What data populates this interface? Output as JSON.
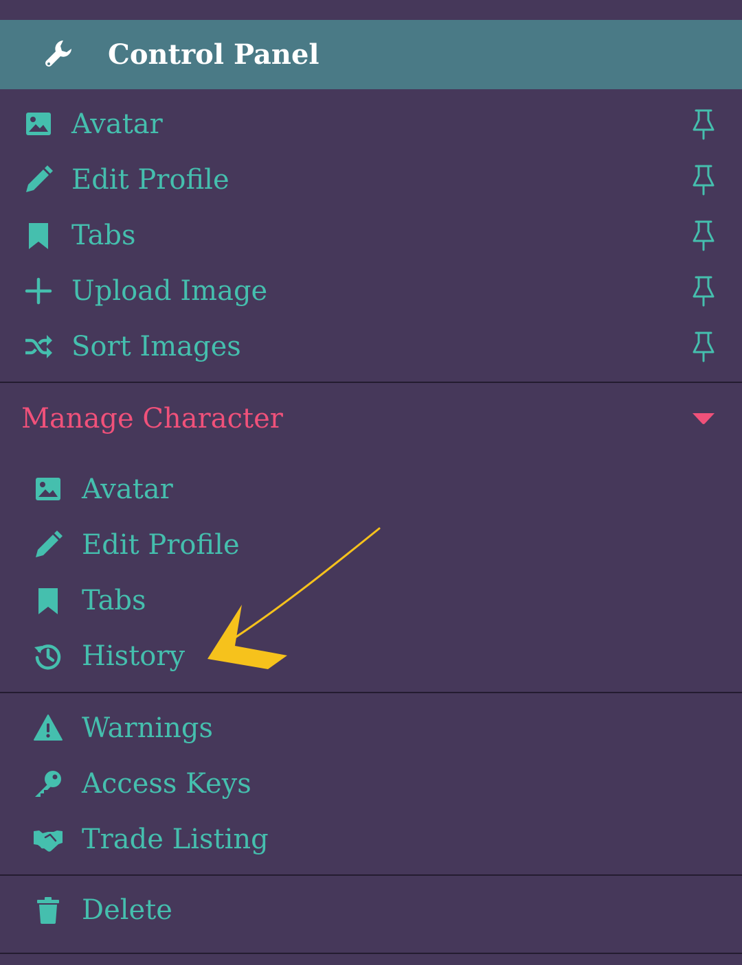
{
  "header": {
    "title": "Control Panel",
    "icon": "wrench-icon"
  },
  "quick_links": [
    {
      "label": "Avatar",
      "icon": "image-icon",
      "pin_icon": "pin-icon"
    },
    {
      "label": "Edit Profile",
      "icon": "pencil-icon",
      "pin_icon": "pin-icon"
    },
    {
      "label": "Tabs",
      "icon": "bookmark-icon",
      "pin_icon": "pin-icon"
    },
    {
      "label": "Upload Image",
      "icon": "plus-icon",
      "pin_icon": "pin-icon"
    },
    {
      "label": "Sort Images",
      "icon": "shuffle-icon",
      "pin_icon": "pin-icon"
    }
  ],
  "manage_character": {
    "title": "Manage Character",
    "expanded": true,
    "caret_icon": "caret-down-icon",
    "items": [
      {
        "label": "Avatar",
        "icon": "image-icon"
      },
      {
        "label": "Edit Profile",
        "icon": "pencil-icon"
      },
      {
        "label": "Tabs",
        "icon": "bookmark-icon"
      },
      {
        "label": "History",
        "icon": "history-icon"
      }
    ]
  },
  "moderation": {
    "items": [
      {
        "label": "Warnings",
        "icon": "warning-icon"
      },
      {
        "label": "Access Keys",
        "icon": "key-icon"
      },
      {
        "label": "Trade Listing",
        "icon": "handshake-icon"
      }
    ]
  },
  "danger": {
    "items": [
      {
        "label": "Delete",
        "icon": "trash-icon"
      }
    ]
  },
  "annotation": {
    "arrow_color": "#f6c21c",
    "points_to": "History"
  },
  "colors": {
    "background": "#46385a",
    "header_bg": "#4a7a86",
    "item_text": "#45bfae",
    "section_title": "#f0517a",
    "divider": "#241c30"
  }
}
